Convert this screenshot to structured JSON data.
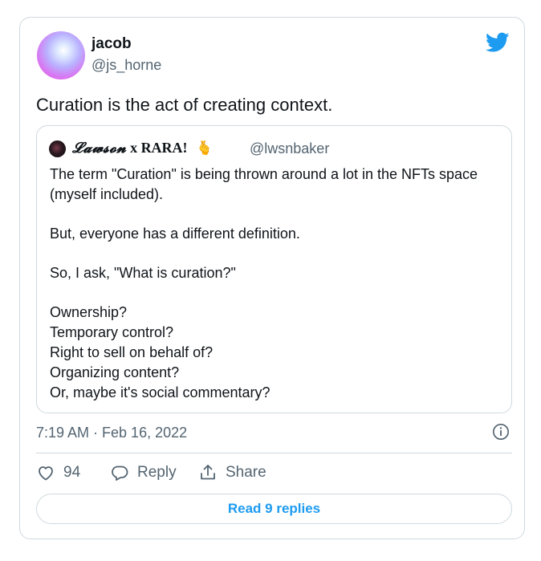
{
  "tweet": {
    "author_name": "jacob",
    "author_handle": "@js_horne",
    "text": "Curation is the act of creating context.",
    "timestamp": "7:19 AM · Feb 16, 2022",
    "likes": "94",
    "reply_label": "Reply",
    "share_label": "Share",
    "read_replies_label": "Read 9 replies"
  },
  "quote": {
    "author_name_script": "𝓛𝓪𝔀𝓼𝓸𝓷",
    "author_name_rest": "x RARA!",
    "author_emoji": "🫰",
    "author_handle": "@lwsnbaker",
    "paragraphs": [
      [
        "The term \"Curation\" is being thrown around a lot in the NFTs space",
        "(myself included)."
      ],
      [
        "But, everyone has a different definition."
      ],
      [
        "So, I ask, \"What is curation?\""
      ],
      [
        "Ownership?",
        "Temporary control?",
        "Right to sell on behalf of?",
        "Organizing content?",
        "Or, maybe it's social commentary?"
      ]
    ]
  },
  "colors": {
    "brand_blue": "#1d9bf0",
    "muted": "#536471",
    "border": "#cfd9de"
  },
  "icons": [
    "twitter-bird-icon",
    "info-icon",
    "heart-icon",
    "reply-icon",
    "share-icon"
  ]
}
